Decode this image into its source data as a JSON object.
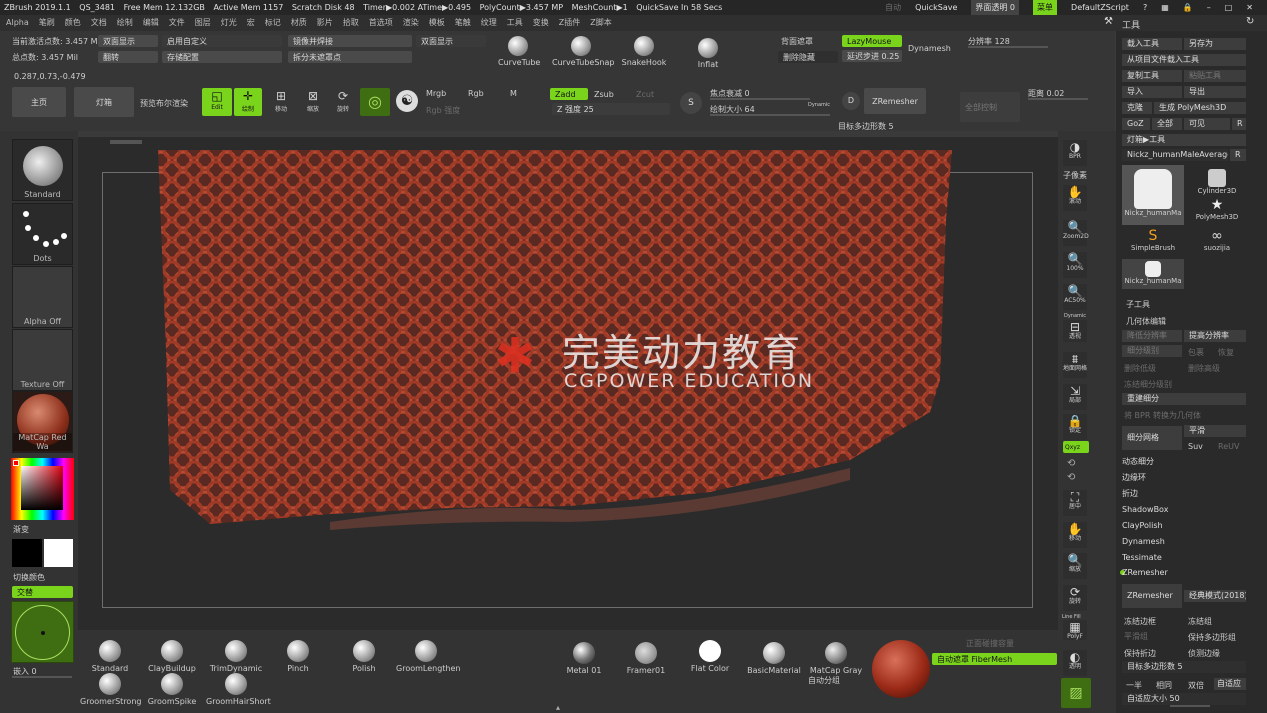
{
  "titlebar": {
    "app": "ZBrush 2019.1.1",
    "qs": "QS_3481",
    "free_mem": "Free Mem 12.132GB",
    "active_mem": "Active Mem 1157",
    "scratch": "Scratch Disk 48",
    "timer": "Timer▶0.002 ATime▶0.495",
    "polycount": "PolyCount▶3.457 MP",
    "meshcount": "MeshCount▶1",
    "quicksave_in": "QuickSave In 58 Secs",
    "auto": "自动",
    "quicksave": "QuickSave",
    "transparency": "界面透明 0",
    "menu": "菜单",
    "script": "DefaultZScript"
  },
  "menus": [
    "Alpha",
    "笔刷",
    "颜色",
    "文档",
    "绘制",
    "编辑",
    "文件",
    "图层",
    "灯光",
    "宏",
    "标记",
    "材质",
    "影片",
    "拾取",
    "首选项",
    "渲染",
    "模板",
    "笔触",
    "纹理",
    "工具",
    "变换",
    "Z插件",
    "Z脚本"
  ],
  "topshelf": {
    "active_points": "当前激活点数: 3.457 Mil",
    "total_points": "总点数: 3.457 Mil",
    "coords": "0.287,0.73,-0.479",
    "double_side": "双面显示",
    "flip": "翻转",
    "enable_custom": "启用自定义",
    "store_config": "存储配置",
    "mirror_weld": "镜像并焊接",
    "split_unmasked": "拆分未遮罩点",
    "double_display": "双面显示",
    "curve_tube": "CurveTube",
    "curve_tube_snap": "CurveTubeSnap",
    "snake_hook": "SnakeHook",
    "inflat": "Inflat",
    "backface_mask": "背面遮罩",
    "delete_hidden": "删除隐藏",
    "lazy_mouse": "LazyMouse",
    "lazy_step": "延迟步进 0.25",
    "dynamesh": "Dynamesh",
    "resolution": "分辨率 128",
    "home": "主页",
    "lightbox": "灯箱",
    "preview_bool": "预览布尔渲染",
    "edit": "Edit",
    "draw": "绘制",
    "move": "移动",
    "scale": "缩放",
    "rotate": "旋转",
    "mrgb": "Mrgb",
    "rgb": "Rgb",
    "m": "M",
    "rgb_intensity": "Rgb 强度",
    "zadd": "Zadd",
    "zsub": "Zsub",
    "zcut": "Zcut",
    "z_intensity": "Z 强度 25",
    "focal_shift": "焦点衰减 0",
    "draw_size": "绘制大小 64",
    "dynamic": "Dynamic",
    "zremesher": "ZRemesher",
    "target_poly": "目标多边形数 5",
    "all_control": "全部控制",
    "distance": "距离 0.02"
  },
  "leftpanel": {
    "brush": "Standard",
    "stroke": "Dots",
    "alpha": "Alpha Off",
    "texture": "Texture Off",
    "material": "MatCap Red Wa",
    "gradient": "渐变",
    "switch_color": "切换颜色",
    "alternate": "交替",
    "embed": "嵌入 0"
  },
  "bottomshelf": {
    "brushes": [
      "Standard",
      "ClayBuildup",
      "TrimDynamic",
      "Pinch",
      "Polish",
      "GroomLengthen",
      "GroomerStrong",
      "GroomSpike",
      "GroomHairShort"
    ],
    "materials": [
      "Metal 01",
      "Framer01",
      "Flat Color",
      "BasicMaterial",
      "MatCap Gray"
    ],
    "auto_group": "自动分组",
    "front_collision": "正面碰撞容量",
    "auto_mask_fiber": "自动遮罩 FiberMesh"
  },
  "rightstrip": {
    "bpr": "BPR",
    "subpixel": "子像素",
    "scroll": "滚动",
    "zoom2d": "Zoom2D",
    "hundred": "100%",
    "ac50": "AC50%",
    "dynamic": "Dynamic",
    "persp": "透视",
    "floor": "地面网格",
    "local": "局部",
    "lock": "锁定",
    "xyz": "Qxyz",
    "frame": "居中",
    "move": "移动",
    "zoom": "缩放",
    "rotate": "旋转",
    "linefill": "Line Fill",
    "polyf": "PolyF",
    "transp": "透明"
  },
  "toolpanel": {
    "header": "工具",
    "load_tool": "载入工具",
    "save_as": "另存为",
    "load_from_file": "从项目文件载入工具",
    "copy_tool": "复制工具",
    "paste_tool": "粘贴工具",
    "import": "导入",
    "export": "导出",
    "clone": "克隆",
    "make_polymesh": "生成 PolyMesh3D",
    "goz": "GoZ",
    "all": "全部",
    "visible": "可见",
    "r": "R",
    "lightbox_tools": "灯箱▶工具",
    "current_tool": "Nickz_humanMaleAverage.",
    "tools": [
      "Nickz_humanMa",
      "Cylinder3D",
      "PolyMesh3D",
      "SimpleBrush",
      "suozijia",
      "Nickz_humanMa"
    ],
    "subtool": "子工具",
    "geometry_edit": "几何体编辑",
    "lower_res": "降低分辨率",
    "higher_res": "提高分辨率",
    "sdiv": "细分级别",
    "cage": "包裹",
    "restore": "恢复",
    "del_lower": "删除低级",
    "del_higher": "删除高级",
    "freeze_sdiv": "冻结细分级别",
    "reconstruct": "重建细分",
    "bpr_to_geo": "将 BPR 转换为几何体",
    "divide": "细分网格",
    "smooth": "平滑",
    "suv": "Suv",
    "reuv": "ReUV",
    "dynamic_sub": "动态细分",
    "edgeloop": "边缘环",
    "crease": "折边",
    "shadowbox": "ShadowBox",
    "claypolish": "ClayPolish",
    "dynamesh": "Dynamesh",
    "tessimate": "Tessimate",
    "zremesher_sec": "ZRemesher",
    "zremesher_btn": "ZRemesher",
    "legacy": "经典模式(2018)",
    "freeze_border": "冻结边框",
    "freeze_groups": "冻结组",
    "smooth_groups": "平滑组",
    "keep_groups": "保持多边形组",
    "keep_creases": "保持折边",
    "detect_edges": "侦测边缘",
    "target_poly": "目标多边形数 5",
    "half": "一半",
    "same": "相同",
    "double": "双倍",
    "adaptive": "自适应",
    "adaptive_size": "自适应大小 50"
  },
  "watermark": {
    "cn": "完美动力教育",
    "en": "CGPOWER EDUCATION"
  },
  "colors": {
    "accent": "#7bd41c",
    "mesh": "#a8432f"
  }
}
